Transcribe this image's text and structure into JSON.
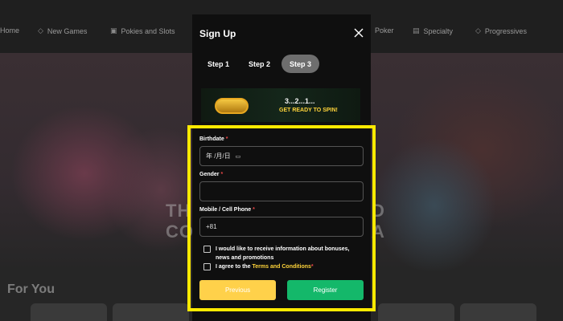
{
  "nav": {
    "items": [
      {
        "label": "Home",
        "icon": "home-icon"
      },
      {
        "label": "New Games",
        "icon": "diamond-icon"
      },
      {
        "label": "Pokies and Slots",
        "icon": "slot-icon"
      },
      {
        "label": "Poker",
        "icon": "cards-icon"
      },
      {
        "label": "Specialty",
        "icon": "gift-icon"
      },
      {
        "label": "Progressives",
        "icon": "diamond-icon"
      }
    ]
  },
  "background": {
    "hero_text_left": "TH\nCO",
    "hero_text_right": "D\nA",
    "section_title": "For You"
  },
  "modal": {
    "title": "Sign Up",
    "close_icon": "close-icon",
    "steps": [
      {
        "label": "Step 1",
        "active": false
      },
      {
        "label": "Step 2",
        "active": false
      },
      {
        "label": "Step 3",
        "active": true
      }
    ],
    "banner": {
      "line1": "3...2...1...",
      "line2": "GET READY TO SPIN!"
    },
    "form": {
      "birthdate_label": "Birthdate",
      "birthdate_value": "年 /月/日",
      "gender_label": "Gender",
      "gender_value": "",
      "phone_label": "Mobile / Cell Phone",
      "phone_value": "+81",
      "required_mark": "*",
      "optin_text": "I would like to receive information about bonuses, news and promotions",
      "terms_prefix": "I agree to the",
      "terms_link": "Terms and Conditions",
      "previous_label": "Previous",
      "register_label": "Register"
    }
  },
  "colors": {
    "highlight": "#ffea00",
    "previous_button": "#ffd14a",
    "register_button": "#14b86a",
    "required": "#e94747",
    "link": "#ffd43a"
  }
}
